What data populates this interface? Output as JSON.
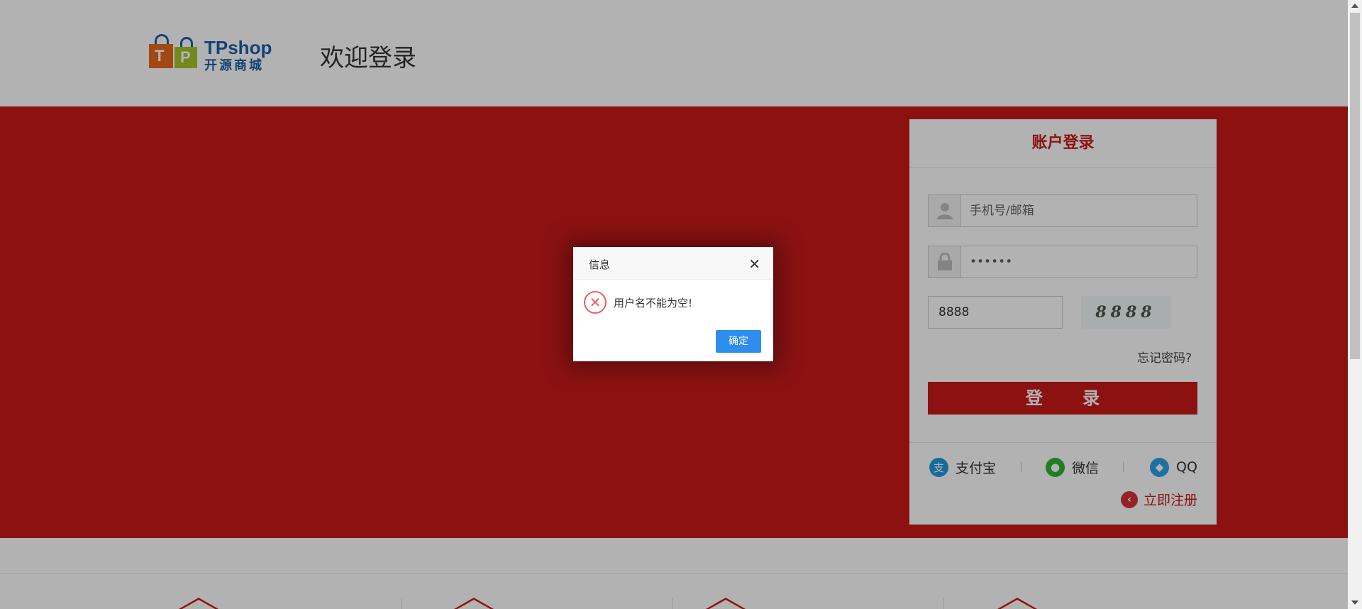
{
  "header": {
    "brand": "TPshop",
    "brand_sub": "开源商城",
    "welcome": "欢迎登录"
  },
  "login": {
    "title": "账户登录",
    "username_placeholder": "手机号/邮箱",
    "password_masked": "••••••",
    "captcha_value": "8888",
    "captcha_image_text": "8888",
    "forgot": "忘记密码?",
    "submit": "登 录",
    "social": [
      {
        "label": "支付宝",
        "icon": "alipay-icon"
      },
      {
        "label": "微信",
        "icon": "wechat-icon"
      },
      {
        "label": "QQ",
        "icon": "qq-icon"
      }
    ],
    "register": "立即注册"
  },
  "modal": {
    "title": "信息",
    "message": "用户名不能为空!",
    "ok": "确定",
    "close_glyph": "✕",
    "error_glyph": "✕"
  },
  "colors": {
    "brand_red": "#c91a1a",
    "brand_blue": "#1d5fa8",
    "modal_button": "#2e8ded",
    "error_red": "#f25d5d"
  }
}
